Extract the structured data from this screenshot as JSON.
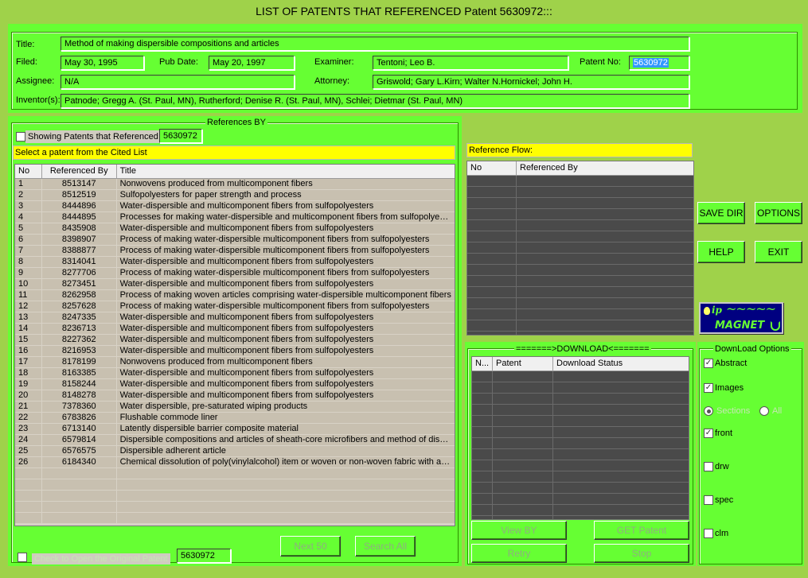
{
  "window": {
    "title": "LIST OF PATENTS THAT REFERENCED  Patent 5630972:::"
  },
  "details": {
    "title_label": "Title:",
    "title_value": "Method of making dispersible compositions and articles",
    "filed_label": "Filed:",
    "filed_value": "May 30, 1995",
    "pubdate_label": "Pub Date:",
    "pubdate_value": "May 20, 1997",
    "examiner_label": "Examiner:",
    "examiner_value": "Tentoni; Leo B.",
    "patentno_label": "Patent No:",
    "patentno_value": "5630972",
    "assignee_label": "Assignee:",
    "assignee_value": "N/A",
    "attorney_label": "Attorney:",
    "attorney_value": "Griswold; Gary L.Kirn; Walter N.Hornickel; John H.",
    "inventors_label": "Inventor(s):",
    "inventors_value": "Patnode; Gregg A. (St. Paul, MN), Rutherford; Denise R. (St. Paul, MN), Schlei; Dietmar (St. Paul, MN)"
  },
  "references": {
    "group_title": "References BY",
    "showing_label": "Showing Patents that Referenced",
    "showing_value": "5630972",
    "select_prompt": "Select a patent from the Cited List",
    "columns": [
      "No",
      "Referenced By",
      "Title"
    ],
    "rows": [
      [
        "1",
        "8513147",
        "Nonwovens produced from multicomponent fibers"
      ],
      [
        "2",
        "8512519",
        "Sulfopolyesters for paper strength and process"
      ],
      [
        "3",
        "8444896",
        "Water-dispersible and multicomponent fibers from sulfopolyesters"
      ],
      [
        "4",
        "8444895",
        "Processes for making water-dispersible and multicomponent fibers from sulfopolyesters"
      ],
      [
        "5",
        "8435908",
        "Water-dispersible and multicomponent fibers from sulfopolyesters"
      ],
      [
        "6",
        "8398907",
        "Process of making water-dispersible multicomponent fibers from sulfopolyesters"
      ],
      [
        "7",
        "8388877",
        "Process of making water-dispersible multicomponent fibers from sulfopolyesters"
      ],
      [
        "8",
        "8314041",
        "Water-dispersible and multicomponent fibers from sulfopolyesters"
      ],
      [
        "9",
        "8277706",
        "Process of making water-dispersible multicomponent fibers from sulfopolyesters"
      ],
      [
        "10",
        "8273451",
        "Water-dispersible and multicomponent fibers from sulfopolyesters"
      ],
      [
        "11",
        "8262958",
        "Process of making woven articles comprising water-dispersible multicomponent fibers"
      ],
      [
        "12",
        "8257628",
        "Process of making water-dispersible multicomponent fibers from sulfopolyesters"
      ],
      [
        "13",
        "8247335",
        "Water-dispersible and multicomponent fibers from sulfopolyesters"
      ],
      [
        "14",
        "8236713",
        "Water-dispersible and multicomponent fibers from sulfopolyesters"
      ],
      [
        "15",
        "8227362",
        "Water-dispersible and multicomponent fibers from sulfopolyesters"
      ],
      [
        "16",
        "8216953",
        "Water-dispersible and multicomponent fibers from sulfopolyesters"
      ],
      [
        "17",
        "8178199",
        "Nonwovens produced from multicomponent fibers"
      ],
      [
        "18",
        "8163385",
        "Water-dispersible and multicomponent fibers from sulfopolyesters"
      ],
      [
        "19",
        "8158244",
        "Water-dispersible and multicomponent fibers from sulfopolyesters"
      ],
      [
        "20",
        "8148278",
        "Water-dispersible and multicomponent fibers from sulfopolyesters"
      ],
      [
        "21",
        "7378360",
        "Water dispersible, pre-saturated wiping products"
      ],
      [
        "22",
        "6783826",
        "Flushable commode liner"
      ],
      [
        "23",
        "6713140",
        "Latently dispersible barrier composite material"
      ],
      [
        "24",
        "6579814",
        "Dispersible compositions and articles of sheath-core microfibers and method of disposa..."
      ],
      [
        "25",
        "6576575",
        "Dispersible adherent article"
      ],
      [
        "26",
        "6184340",
        "Chemical dissolution of poly(vinylalcohol) item or woven or non-woven fabric with antim..."
      ]
    ],
    "open_original_label": "Check to Open the Original Patent",
    "open_original_value": "5630972",
    "next_button": "Next 50",
    "search_all_button": "Search All"
  },
  "reference_flow": {
    "label": "Reference Flow:",
    "columns": [
      "No",
      "Referenced By"
    ]
  },
  "download": {
    "group_title": "=======>DOWNLOAD<=======",
    "columns": [
      "N...",
      "Patent",
      "Download Status"
    ],
    "view_by_button": "View BY",
    "get_patent_button": "GET Patent",
    "retry_button": "Retry",
    "stop_button": "Stop"
  },
  "toolbar": {
    "save_dir": "SAVE DIR",
    "options": "OPTIONS",
    "help": "HELP",
    "exit": "EXIT"
  },
  "logo": {
    "prefix": "ip",
    "waves": "~~~~~",
    "name": "MAGNET"
  },
  "download_options": {
    "group_title": "DownLoad Options",
    "abstract": "Abstract",
    "images": "Images",
    "sections": "Sections",
    "all": "All",
    "front": "front",
    "drw": "drw",
    "spec": "spec",
    "clm": "clm"
  },
  "colors": {
    "panel_green": "#66ff33",
    "window_green": "#9fd24a",
    "highlight_yellow": "#ffff00",
    "logo_blue": "#000080"
  }
}
